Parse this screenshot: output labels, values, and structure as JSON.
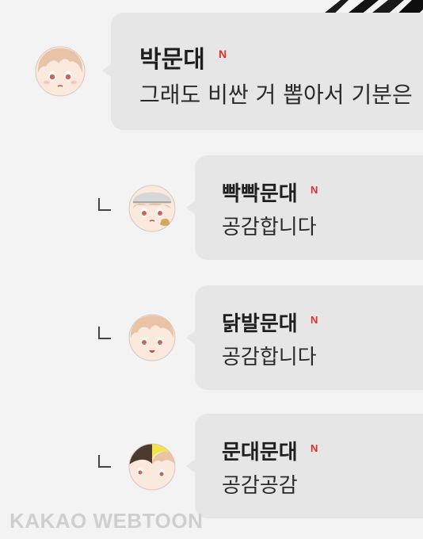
{
  "comments": [
    {
      "author": "박문대",
      "badge": "N",
      "text": "그래도 비싼 거 뽑아서 기분은",
      "avatar_icon": "character-face-icon"
    }
  ],
  "replies": [
    {
      "author": "빡빡문대",
      "badge": "N",
      "text": "공감합니다",
      "avatar_icon": "character-face-icon"
    },
    {
      "author": "닭발문대",
      "badge": "N",
      "text": "공감합니다",
      "avatar_icon": "character-face-icon"
    },
    {
      "author": "문대문대",
      "badge": "N",
      "text": "공감공감",
      "avatar_icon": "character-pair-face-icon"
    }
  ],
  "watermark": "KAKAO WEBTOON",
  "colors": {
    "background": "#f3f3f3",
    "bubble": "#e6e6e6",
    "new_badge": "#e1302a"
  }
}
